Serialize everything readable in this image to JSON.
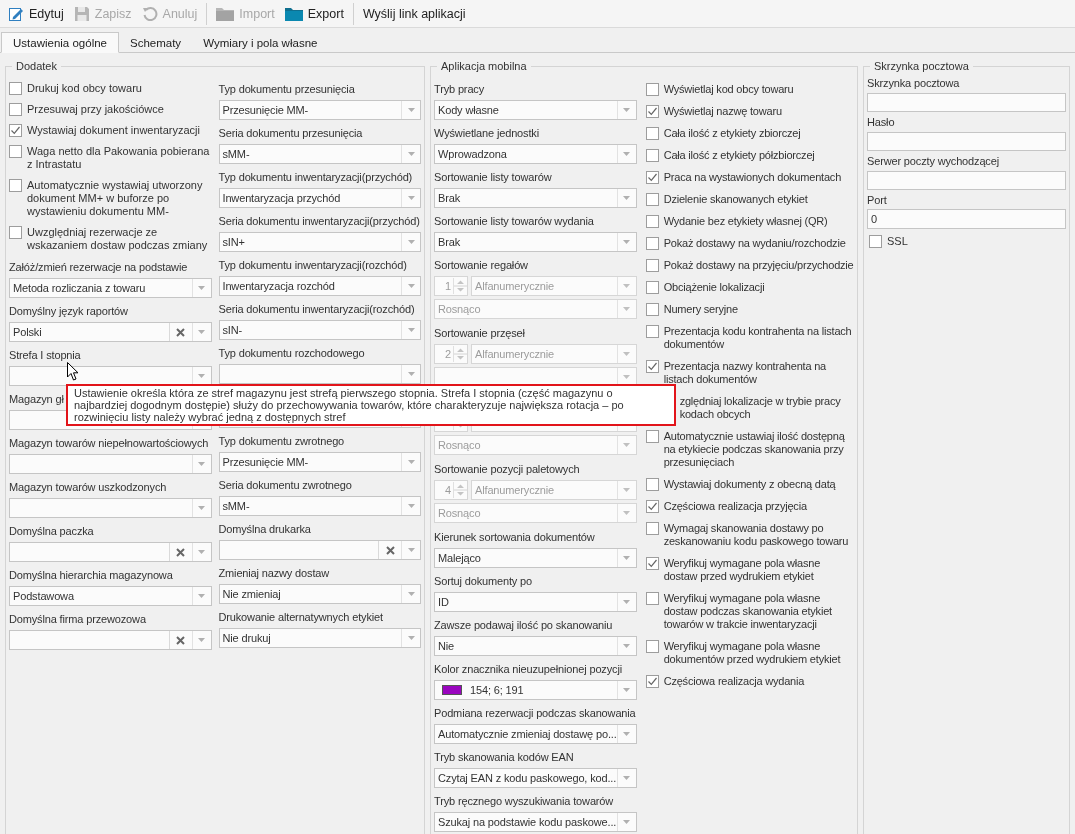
{
  "toolbar": [
    {
      "kind": "edit",
      "label": "Edytuj",
      "disabled": false
    },
    {
      "kind": "save",
      "label": "Zapisz",
      "disabled": true
    },
    {
      "kind": "undo",
      "label": "Anuluj",
      "disabled": true
    },
    {
      "kind": "separator"
    },
    {
      "kind": "import",
      "label": "Import",
      "disabled": true
    },
    {
      "kind": "export",
      "label": "Export",
      "disabled": false
    },
    {
      "kind": "separator"
    },
    {
      "kind": "text",
      "label": "Wyślij link aplikacji",
      "disabled": false
    }
  ],
  "tabs": [
    {
      "label": "Ustawienia ogólne",
      "selected": true
    },
    {
      "label": "Schematy",
      "selected": false
    },
    {
      "label": "Wymiary i pola własne",
      "selected": false
    }
  ],
  "dodatek": {
    "title": "Dodatek",
    "checkboxes": [
      {
        "label": "Drukuj kod obcy towaru",
        "checked": false
      },
      {
        "label": "Przesuwaj przy jakościówce",
        "checked": false
      },
      {
        "label": "Wystawiaj dokument inwentaryzacji",
        "checked": true
      },
      {
        "label": "Waga netto dla Pakowania pobierana z Intrastatu",
        "checked": false
      },
      {
        "label": "Automatycznie wystawiaj utworzony dokument MM+ w buforze po wystawieniu dokumentu MM-",
        "checked": false
      },
      {
        "label": "Uwzględniaj rezerwacje ze wskazaniem dostaw podczas zmiany",
        "checked": false
      }
    ],
    "column_1": [
      {
        "kind": "dropdown",
        "label": "Załóż/zmień rezerwacje na podstawie",
        "value": "Metoda rozliczania z towaru",
        "clearable": false
      },
      {
        "kind": "dropdown",
        "label": "Domyślny język raportów",
        "value": "Polski",
        "clearable": true
      },
      {
        "kind": "dropdown",
        "label": "Strefa I stopnia",
        "clearable": false
      },
      {
        "kind": "dropdown",
        "label": "Magazyn gł"
      },
      {
        "kind": "dropdown",
        "label": "Magazyn towarów niepełnowartościowych",
        "clearable": false
      },
      {
        "kind": "dropdown",
        "label": "Magazyn towarów uszkodzonych",
        "clearable": false
      },
      {
        "kind": "dropdown",
        "label": "Domyślna paczka",
        "clearable": true
      },
      {
        "kind": "dropdown",
        "label": "Domyślna hierarchia magazynowa",
        "value": "Podstawowa",
        "clearable": false
      },
      {
        "kind": "dropdown",
        "label": "Domyślna firma przewozowa",
        "clearable": true
      }
    ],
    "column_2": [
      {
        "kind": "dropdown",
        "label": "Typ dokumentu przesunięcia",
        "value": "Przesunięcie MM-",
        "clearable": false
      },
      {
        "kind": "dropdown",
        "label": "Seria dokumentu przesunięcia",
        "value": "sMM-",
        "clearable": false
      },
      {
        "kind": "dropdown",
        "label": "Typ dokumentu inwentaryzacji(przychód)",
        "value": "Inwentaryzacja przychód",
        "clearable": false
      },
      {
        "kind": "dropdown",
        "label": "Seria dokumentu inwentaryzacji(przychód)",
        "value": "sIN+",
        "clearable": false
      },
      {
        "kind": "dropdown",
        "label": "Typ dokumentu inwentaryzacji(rozchód)",
        "value": "Inwentaryzacja rozchód",
        "clearable": false
      },
      {
        "kind": "dropdown",
        "label": "Seria dokumentu inwentaryzacji(rozchód)",
        "value": "sIN-",
        "clearable": false
      },
      {
        "kind": "dropdown",
        "label": "Typ dokumentu rozchodowego",
        "clearable": false
      },
      {
        "kind": "dropdown"
      },
      {
        "kind": "dropdown",
        "label": "Typ dokumentu zwrotnego",
        "value": "Przesunięcie MM-",
        "clearable": false
      },
      {
        "kind": "dropdown",
        "label": "Seria dokumentu zwrotnego",
        "value": "sMM-",
        "clearable": false
      },
      {
        "kind": "dropdown",
        "label": "Domyślna drukarka",
        "clearable": true
      },
      {
        "kind": "dropdown",
        "label": "Zmieniaj nazwy dostaw",
        "value": "Nie zmieniaj",
        "clearable": false
      },
      {
        "kind": "dropdown",
        "label": "Drukowanie alternatywnych etykiet",
        "value": "Nie drukuj",
        "clearable": false
      }
    ]
  },
  "mobile": {
    "title": "Aplikacja mobilna",
    "fields": [
      {
        "kind": "select",
        "label": "Tryb pracy",
        "value": "Kody własne"
      },
      {
        "kind": "select",
        "label": "Wyświetlane jednostki",
        "value": "Wprowadzona"
      },
      {
        "kind": "select",
        "label": "Sortowanie listy towarów",
        "value": "Brak"
      },
      {
        "kind": "select",
        "label": "Sortowanie listy towarów wydania",
        "value": "Brak"
      },
      {
        "kind": "sort",
        "label": "Sortowanie regałów",
        "number": "1",
        "order": "Alfanumerycznie",
        "direction": "Rosnąco",
        "disabled": true
      },
      {
        "kind": "sort",
        "label": "Sortowanie przęseł",
        "number": "2",
        "order": "Alfanumerycznie",
        "disabled": true
      },
      {
        "kind": "sort",
        "direction": "Rosnąco",
        "disabled": true
      },
      {
        "kind": "sort",
        "label": "Sortowanie pozycji paletowych",
        "number": "4",
        "order": "Alfanumerycznie",
        "direction": "Rosnąco",
        "disabled": true
      },
      {
        "kind": "select",
        "label": "Kierunek sortowania dokumentów",
        "value": "Malejąco"
      },
      {
        "kind": "select",
        "label": "Sortuj dokumenty po",
        "value": "ID"
      },
      {
        "kind": "select",
        "label": "Zawsze podawaj ilość po skanowaniu",
        "value": "Nie"
      },
      {
        "kind": "color",
        "label": "Kolor znacznika nieuzupełnionej pozycji",
        "value": "154; 6; 191",
        "color": "#9a06bf"
      },
      {
        "kind": "select",
        "label": "Podmiana rezerwacji podczas skanowania",
        "value": "Automatycznie zmieniaj dostawę po..."
      },
      {
        "kind": "select",
        "label": "Tryb skanowania kodów EAN",
        "value": "Czytaj EAN z kodu paskowego, kod..."
      },
      {
        "kind": "select",
        "label": "Tryb ręcznego wyszukiwania towarów",
        "value": "Szukaj na podstawie kodu paskowe..."
      }
    ],
    "checkboxes": [
      {
        "kind": "checkbox",
        "label": "Wyświetlaj kod obcy towaru",
        "checked": false
      },
      {
        "kind": "checkbox",
        "label": "Wyświetlaj nazwę towaru",
        "checked": true
      },
      {
        "kind": "checkbox",
        "label": "Cała ilość z etykiety zbiorczej",
        "checked": false
      },
      {
        "kind": "checkbox",
        "label": "Cała ilość z etykiety półzbiorczej",
        "checked": false
      },
      {
        "kind": "checkbox",
        "label": "Praca na wystawionych dokumentach",
        "checked": true
      },
      {
        "kind": "checkbox",
        "label": "Dzielenie skanowanych etykiet",
        "checked": false
      },
      {
        "kind": "checkbox",
        "label": "Wydanie bez etykiety własnej (QR)",
        "checked": false
      },
      {
        "kind": "checkbox",
        "label": "Pokaż dostawy na wydaniu/rozchodzie",
        "checked": false
      },
      {
        "kind": "checkbox",
        "label": "Pokaż dostawy na przyjęciu/przychodzie",
        "checked": false
      },
      {
        "kind": "checkbox",
        "label": "Obciążenie lokalizacji",
        "checked": false
      },
      {
        "kind": "checkbox",
        "label": "Numery seryjne",
        "checked": false
      },
      {
        "kind": "checkbox",
        "label": "Prezentacja kodu kontrahenta na listach dokumentów",
        "checked": false
      },
      {
        "kind": "checkbox",
        "label": "Prezentacja nazwy kontrahenta na listach dokumentów",
        "checked": true
      },
      {
        "kind": "covered",
        "lines": [
          "zględniaj lokalizacje w trybie pracy",
          "kodach obcych"
        ]
      },
      {
        "kind": "checkbox",
        "label": "Automatycznie ustawiaj ilość dostępną na etykiecie podczas skanowania przy przesunięciach",
        "checked": false
      },
      {
        "kind": "checkbox",
        "label": "Wystawiaj dokumenty z obecną datą",
        "checked": false
      },
      {
        "kind": "checkbox",
        "label": "Częściowa realizacja przyjęcia",
        "checked": true
      },
      {
        "kind": "checkbox",
        "label": "Wymagaj skanowania dostawy po zeskanowaniu kodu paskowego towaru",
        "checked": false
      },
      {
        "kind": "checkbox",
        "label": "Weryfikuj wymagane pola własne dostaw przed wydrukiem etykiet",
        "checked": true
      },
      {
        "kind": "checkbox",
        "label": "Weryfikuj wymagane pola własne dostaw podczas skanowania etykiet towarów w trakcie inwentaryzacji",
        "checked": false
      },
      {
        "kind": "checkbox",
        "label": "Weryfikuj wymagane pola własne dokumentów przed wydrukiem etykiet",
        "checked": false
      },
      {
        "kind": "checkbox",
        "label": "Częściowa realizacja wydania",
        "checked": true
      }
    ]
  },
  "mail": {
    "title": "Skrzynka pocztowa",
    "fields": [
      {
        "label": "Skrzynka pocztowa"
      },
      {
        "label": "Hasło"
      },
      {
        "label": "Serwer poczty wychodzącej"
      },
      {
        "label": "Port",
        "value": "0"
      }
    ],
    "checkbox": {
      "label": "SSL",
      "checked": false
    }
  },
  "tooltip": {
    "text": "Ustawienie określa która ze stref magazynu jest strefą pierwszego stopnia. Strefa I stopnia (część magazynu o najbardziej dogodnym dostępie) służy do przechowywania towarów, które charakteryzuje największa rotacja – po rozwinięciu listy należy wybrać jedną z dostępnych stref"
  }
}
